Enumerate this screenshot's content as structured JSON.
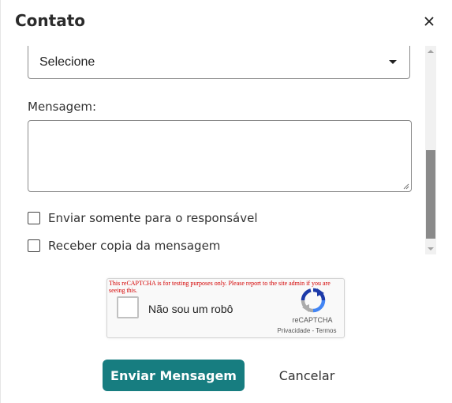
{
  "modal": {
    "title": "Contato",
    "close_icon": "close-icon"
  },
  "form": {
    "select": {
      "value": "Selecione",
      "icon": "caret-down-icon"
    },
    "message_label": "Mensagem:",
    "message_value": "",
    "checkboxes": [
      {
        "label": "Enviar somente para o responsável",
        "checked": false
      },
      {
        "label": "Receber copia da mensagem",
        "checked": false
      }
    ]
  },
  "recaptcha": {
    "warning": "This reCAPTCHA is for testing purposes only. Please report to the site admin if you are seeing this.",
    "label": "Não sou um robô",
    "brand": "reCAPTCHA",
    "links": "Privacidade - Termos",
    "icon": "recaptcha-logo-icon"
  },
  "actions": {
    "send_label": "Enviar Mensagem",
    "cancel_label": "Cancelar",
    "send_color": "#177d80"
  }
}
